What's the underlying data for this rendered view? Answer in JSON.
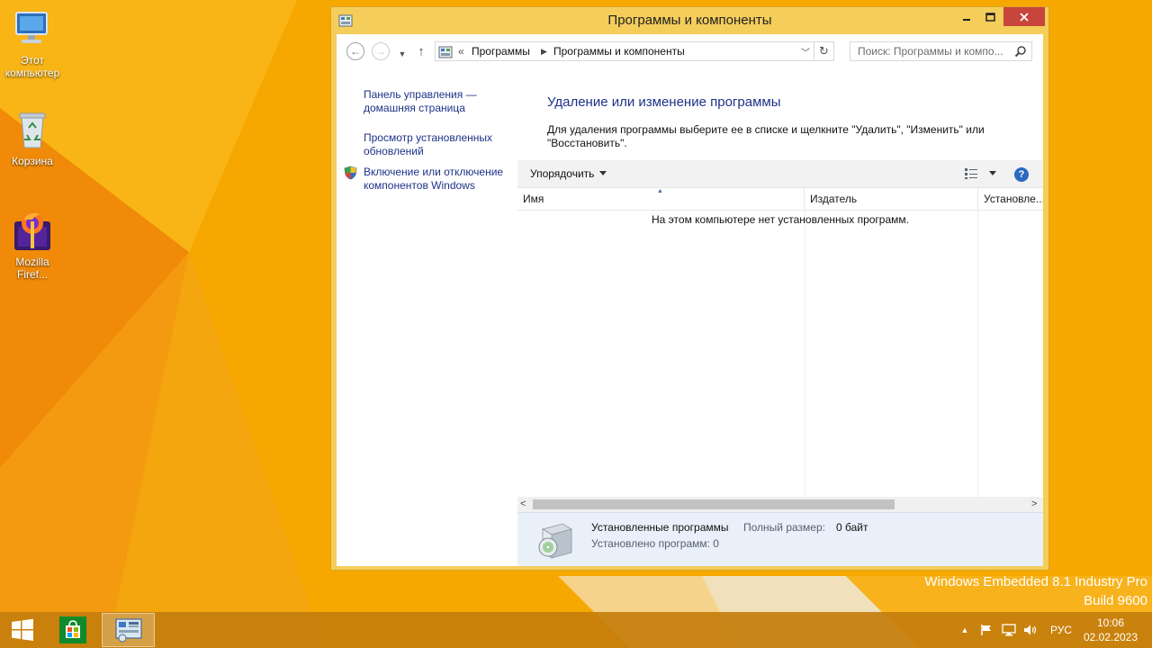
{
  "desktop": {
    "icons": [
      {
        "label": "Этот компьютер",
        "icon": "computer-icon"
      },
      {
        "label": "Корзина",
        "icon": "recycle-bin-icon"
      },
      {
        "label": "Mozilla Firef...",
        "icon": "firefox-icon"
      }
    ],
    "watermark": {
      "line1": "Windows Embedded 8.1 Industry Pro",
      "line2": "Build 9600"
    },
    "wallpaper_color": "#f7a800"
  },
  "window": {
    "title": "Программы и компоненты",
    "icon": "control-panel-icon",
    "frame_color": "#f4cd5b",
    "close_color": "#c7453a",
    "buttons": {
      "minimize": "minimize-icon",
      "maximize": "maximize-icon",
      "close": "close-icon"
    }
  },
  "navigation": {
    "address_chevron": "«",
    "breadcrumbs": [
      "Программы",
      "Программы и компоненты"
    ],
    "breadcrumb_separator": "▶",
    "search_placeholder": "Поиск: Программы и компо..."
  },
  "sidebar": {
    "links": [
      {
        "label": "Панель управления — домашняя страница"
      },
      {
        "label": "Просмотр установленных обновлений"
      },
      {
        "label": "Включение или отключение компонентов Windows",
        "icon": "shield-icon"
      }
    ]
  },
  "main": {
    "heading": "Удаление или изменение программы",
    "description": "Для удаления программы выберите ее в списке и щелкните \"Удалить\", \"Изменить\" или \"Восстановить\".",
    "link_color": "#1e3287"
  },
  "toolbar": {
    "organize_label": "Упорядочить",
    "help_label": "?"
  },
  "program_list": {
    "columns": [
      "Имя",
      "Издатель",
      "Установле..."
    ],
    "sorted_column": "Имя",
    "empty_message": "На этом компьютере нет установленных программ."
  },
  "details": {
    "title": "Установленные программы",
    "size_label": "Полный размер:",
    "size_value": "0 байт",
    "count_text": "Установлено программ: 0"
  },
  "taskbar": {
    "tray": {
      "language": "РУС",
      "time": "10:06",
      "date": "02.02.2023"
    },
    "color": "#c47e0c"
  }
}
